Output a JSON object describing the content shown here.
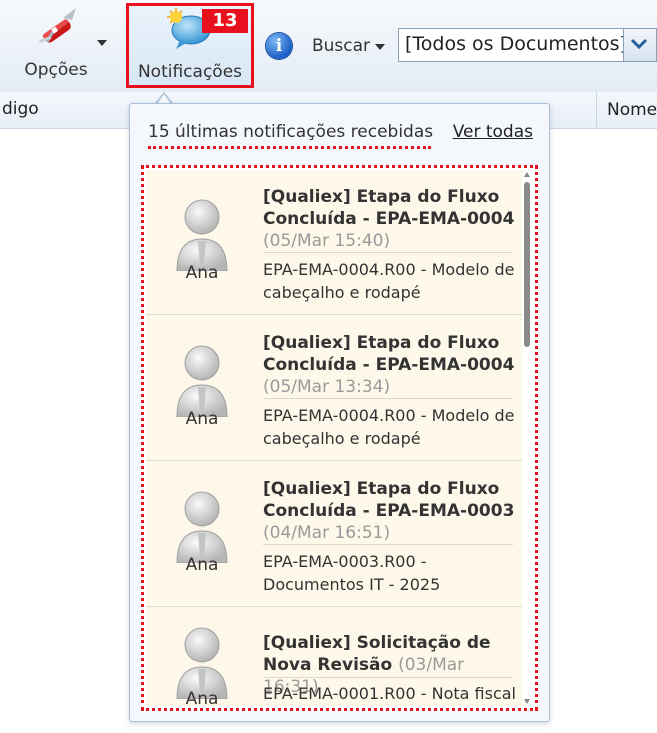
{
  "toolbar": {
    "opcoes_label": "Opções",
    "notificacoes_label": "Notificações",
    "notificacoes_count": "13",
    "buscar_label": "Buscar",
    "document_filter": "[Todos os Documentos]",
    "badge_color": "#e8101c"
  },
  "columns": {
    "codigo": "digo",
    "nome": "Nome"
  },
  "popup": {
    "header": "15 últimas notificações recebidas",
    "ver_todas": "Ver todas",
    "items": [
      {
        "author": "Ana",
        "title": "[Qualiex] Etapa do Fluxo Concluída - EPA-EMA-0004",
        "date": "(05/Mar 15:40)",
        "description": "EPA-EMA-0004.R00 - Modelo de cabeçalho e rodapé"
      },
      {
        "author": "Ana",
        "title": "[Qualiex] Etapa do Fluxo Concluída - EPA-EMA-0004",
        "date": "(05/Mar 13:34)",
        "description": "EPA-EMA-0004.R00 - Modelo de cabeçalho e rodapé"
      },
      {
        "author": "Ana",
        "title": "[Qualiex] Etapa do Fluxo Concluída - EPA-EMA-0003",
        "date": "(04/Mar 16:51)",
        "description": "EPA-EMA-0003.R00 - Documentos IT - 2025"
      },
      {
        "author": "Ana",
        "title": "[Qualiex] Solicitação de Nova Revisão",
        "date": "(03/Mar 16:31)",
        "description": "EPA-EMA-0001.R00 - Nota fiscal"
      }
    ]
  }
}
